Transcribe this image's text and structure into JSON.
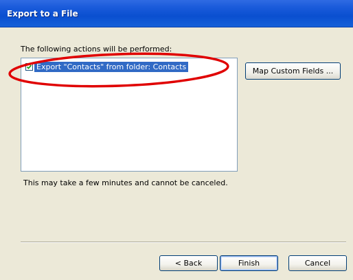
{
  "window": {
    "title": "Export to a File"
  },
  "actions": {
    "heading": "The following actions will be performed:",
    "items": [
      {
        "label": "Export \"Contacts\" from folder: Contacts",
        "checked": true
      }
    ]
  },
  "buttons": {
    "map_fields": "Map Custom Fields ...",
    "back": "< Back",
    "finish": "Finish",
    "cancel": "Cancel"
  },
  "note": "This may take a few minutes and cannot be canceled.",
  "colors": {
    "titlebar": "#0a4fd0",
    "selection": "#316ac5",
    "annotation": "#e00000",
    "dialog_bg": "#ece9d8"
  }
}
